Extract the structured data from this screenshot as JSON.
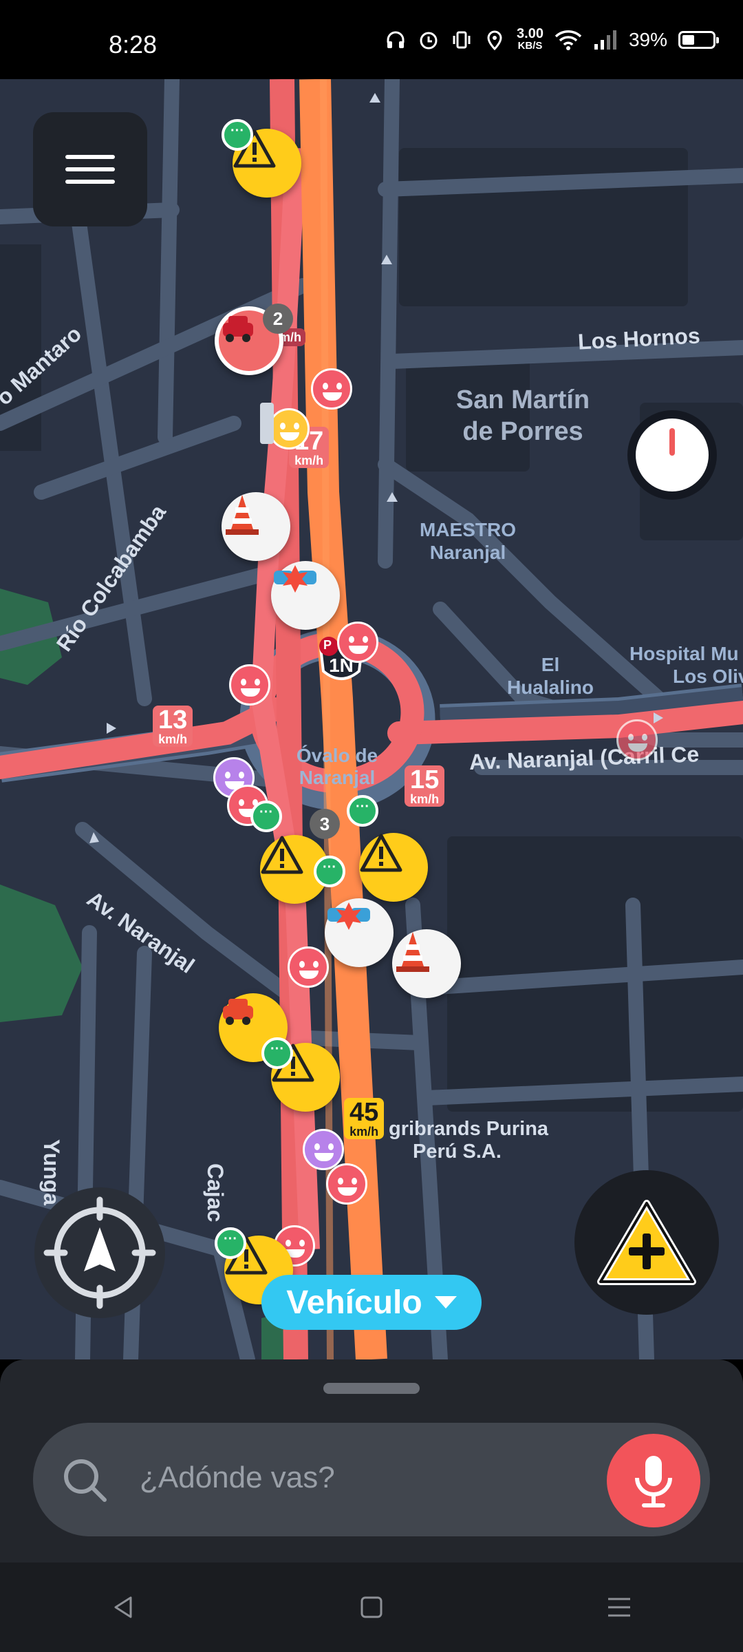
{
  "status_bar": {
    "time": "8:28",
    "net_speed_value": "3.00",
    "net_speed_unit": "KB/S",
    "battery": "39%",
    "icons": [
      "headphones-icon",
      "alarm-icon",
      "vibrate-icon",
      "location-icon",
      "wifi-icon",
      "signal-icon",
      "battery-icon"
    ]
  },
  "map": {
    "labels": {
      "los_hornos": "Los Hornos",
      "district_line1": "San Martín",
      "district_line2": "de Porres",
      "maestro_line1": "MAESTRO",
      "maestro_line2": "Naranjal",
      "el_hualine1": "El",
      "el_hualine2": "Hualalino",
      "hospital_line1": "Hospital Mu",
      "hospital_line2": "Los Oliv",
      "ovalo_line1": "Óvalo de",
      "ovalo_line2": "Naranjal",
      "av_naranjal_carril": "Av. Naranjal (Carril Ce",
      "av_naranjal": "Av. Naranjal",
      "rio_colcabamba": "Río Colcabamba",
      "mantaro": "o Mantaro",
      "agribrands_line1": "gribrands Purina",
      "agribrands_line2": "Perú S.A.",
      "yunga": "Yunga",
      "cajac": "Cajac",
      "route_shield": "1N",
      "parking_letter": "P"
    },
    "speed_tags": [
      {
        "value": "17",
        "unit": "km/h"
      },
      {
        "value": "13",
        "unit": "km/h"
      },
      {
        "value": "15",
        "unit": "km/h"
      },
      {
        "value": "45",
        "unit": "km/h"
      }
    ],
    "partial_speed_unit": "m/h",
    "count_badges": [
      "2",
      "3"
    ]
  },
  "controls": {
    "vehicle_label": "Vehículo",
    "search_placeholder": "¿Adónde vas?"
  },
  "colors": {
    "map_bg": "#2b3344",
    "route_orange": "#ff8a4c",
    "traffic_red": "#f0686d",
    "accent_blue": "#33c8f2",
    "mic_red": "#f2545a",
    "hazard_yellow": "#ffcc1a"
  }
}
